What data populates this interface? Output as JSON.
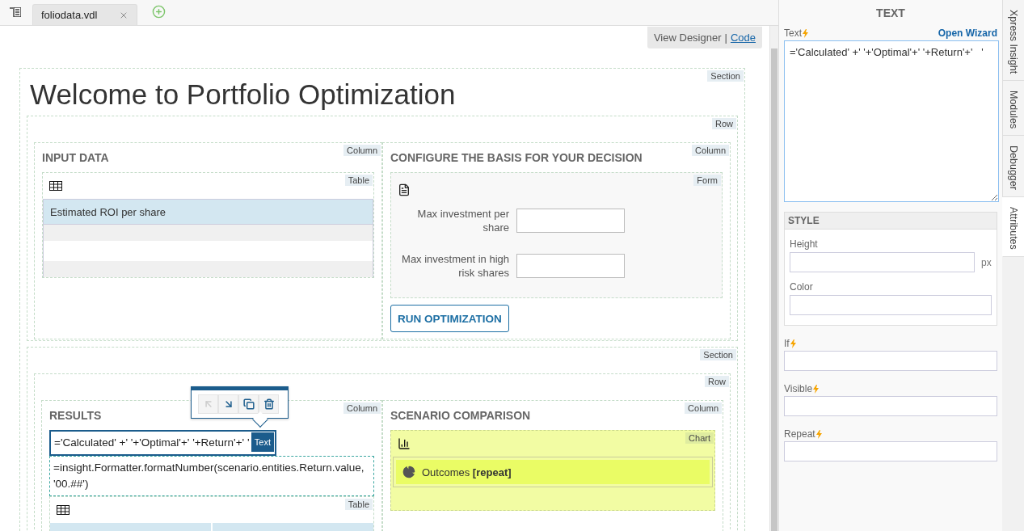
{
  "file_tabs": [
    {
      "label": "foliodata.vdl",
      "selected": true
    }
  ],
  "view_switch": {
    "separator": "|",
    "options": [
      {
        "label": "View Designer",
        "selected": true
      },
      {
        "label": "Code",
        "selected": false
      }
    ]
  },
  "page": {
    "kind": "section",
    "tag": "Section",
    "title": "Welcome to Portfolio Optimization",
    "children": [
      {
        "kind": "row",
        "tag": "Row",
        "columns": [
          {
            "tag": "Column",
            "heading": "INPUT DATA",
            "components": [
              {
                "kind": "table",
                "tag": "Table",
                "header": "Estimated ROI per share",
                "rows": [
                  {
                    "shaded": true
                  },
                  {
                    "shaded": false
                  },
                  {
                    "shaded": true
                  }
                ]
              }
            ]
          },
          {
            "tag": "Column",
            "heading": "CONFIGURE THE BASIS FOR YOUR DECISION",
            "components": [
              {
                "kind": "form",
                "tag": "Form",
                "fields": [
                  {
                    "label": "Max investment per share"
                  },
                  {
                    "label": "Max investment in high risk shares"
                  }
                ]
              },
              {
                "kind": "button",
                "label": "RUN OPTIMIZATION"
              }
            ]
          }
        ]
      },
      {
        "kind": "section",
        "tag": "Section",
        "children": [
          {
            "kind": "row",
            "tag": "Row",
            "columns": [
              {
                "tag": "Column",
                "heading": "RESULTS",
                "toolbar": [
                  {
                    "kind": "move-up",
                    "disabled": true
                  },
                  {
                    "kind": "move-down",
                    "disabled": false
                  },
                  {
                    "kind": "copy",
                    "disabled": false
                  },
                  {
                    "kind": "delete",
                    "disabled": false
                  }
                ],
                "components": [
                  {
                    "kind": "text",
                    "tag": "Text",
                    "selected": true,
                    "text": "='Calculated' +' '+'Optimal'+' '+Return'+' '"
                  },
                  {
                    "kind": "text",
                    "selected": false,
                    "text": "=insight.Formatter.formatNumber(scenario.entities.Return.value, '00.##')"
                  },
                  {
                    "kind": "table",
                    "tag": "Table"
                  }
                ]
              },
              {
                "tag": "Column",
                "heading": "SCENARIO COMPARISON",
                "components": [
                  {
                    "kind": "chart",
                    "tag": "Chart",
                    "series": "Outcomes **[repeat]**"
                  }
                ]
              }
            ]
          }
        ]
      }
    ]
  },
  "properties": {
    "title": "TEXT",
    "text_field": {
      "label": "Text",
      "dynamic": true,
      "link": "Open Wizard",
      "value": "='Calculated' +' '+'Optimal'+' '+Return'+'   '"
    },
    "style": {
      "title": "STYLE",
      "height": {
        "label": "Height",
        "unit": "px"
      },
      "color": {
        "label": "Color"
      }
    },
    "fields": [
      {
        "label": "If",
        "dynamic": true
      },
      {
        "label": "Visible",
        "dynamic": true
      },
      {
        "label": "Repeat",
        "dynamic": true
      }
    ]
  },
  "side_tabs": [
    {
      "label": "Xpress Insight",
      "selected": false
    },
    {
      "label": "Modules",
      "selected": false
    },
    {
      "label": "Debugger",
      "selected": false
    },
    {
      "label": "Attributes",
      "selected": true
    }
  ]
}
